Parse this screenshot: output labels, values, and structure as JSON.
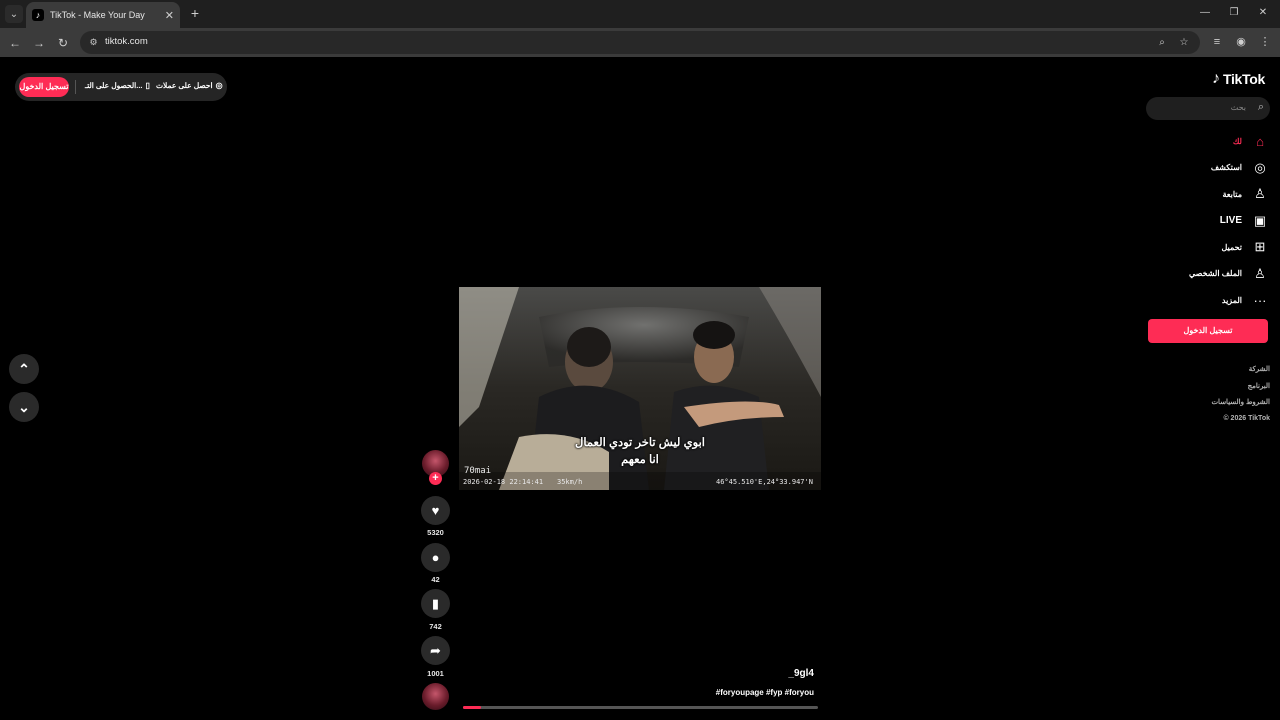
{
  "browser": {
    "tab_title": "TikTok - Make Your Day",
    "url": "tiktok.com"
  },
  "top_bar": {
    "login_label": "تسجيل الدخول",
    "get_app_label": "الحصول على التـ...",
    "coins_label": "احصل على عملات"
  },
  "brand": {
    "name": "TikTok"
  },
  "search": {
    "placeholder": "بحث"
  },
  "sidebar": {
    "items": [
      {
        "label": "لك",
        "icon": "home-icon"
      },
      {
        "label": "استكشف",
        "icon": "compass-icon"
      },
      {
        "label": "متابعة",
        "icon": "user-plus-icon"
      },
      {
        "label": "LIVE",
        "icon": "live-icon"
      },
      {
        "label": "تحميل",
        "icon": "upload-icon"
      },
      {
        "label": "الملف الشخصي",
        "icon": "profile-icon"
      },
      {
        "label": "المزيد",
        "icon": "more-icon"
      }
    ],
    "login_button": "تسجيل الدخول",
    "footer": [
      "الشركة",
      "البرنامج",
      "الشروط والسياسات",
      "© 2026 TikTok"
    ]
  },
  "video": {
    "subtitle_line1": "ابوي ليش تاخر تودي العمال",
    "subtitle_line2": "انا معهم",
    "camera_brand": "70mai",
    "timestamp": "2026-02-18 22:14:41",
    "speed": "35km/h",
    "gps": "46°45.510'E,24°33.947'N",
    "author": "_9gl4",
    "hashtags": "#foryoupage #fyp #foryou",
    "progress": 0.05
  },
  "actions": {
    "likes": "5320",
    "comments": "42",
    "saves": "742",
    "shares": "1001"
  },
  "colors": {
    "accent": "#fe2c55",
    "background": "#000000"
  }
}
